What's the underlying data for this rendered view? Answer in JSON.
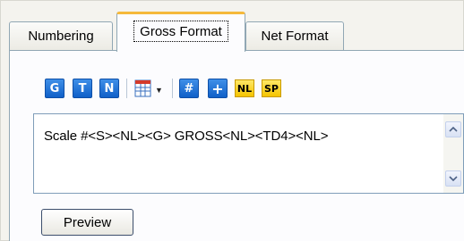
{
  "tabs": {
    "numbering": "Numbering",
    "gross_format": "Gross Format",
    "net_format": "Net Format",
    "active": "Gross Format"
  },
  "toolbar": {
    "g_label": "G",
    "t_label": "T",
    "n_label": "N",
    "grid_icon": "table-dropdown-icon",
    "hash_label": "#",
    "plus_label": "+",
    "nl_label": "NL",
    "sp_label": "SP"
  },
  "editor": {
    "value": "Scale #<S><NL><G> GROSS<NL><TD4><NL>"
  },
  "buttons": {
    "preview": "Preview"
  },
  "colors": {
    "active_tab_accent": "#f5b93b",
    "toolbar_blue": "#1060c8",
    "toolbar_yellow": "#f5c400"
  }
}
